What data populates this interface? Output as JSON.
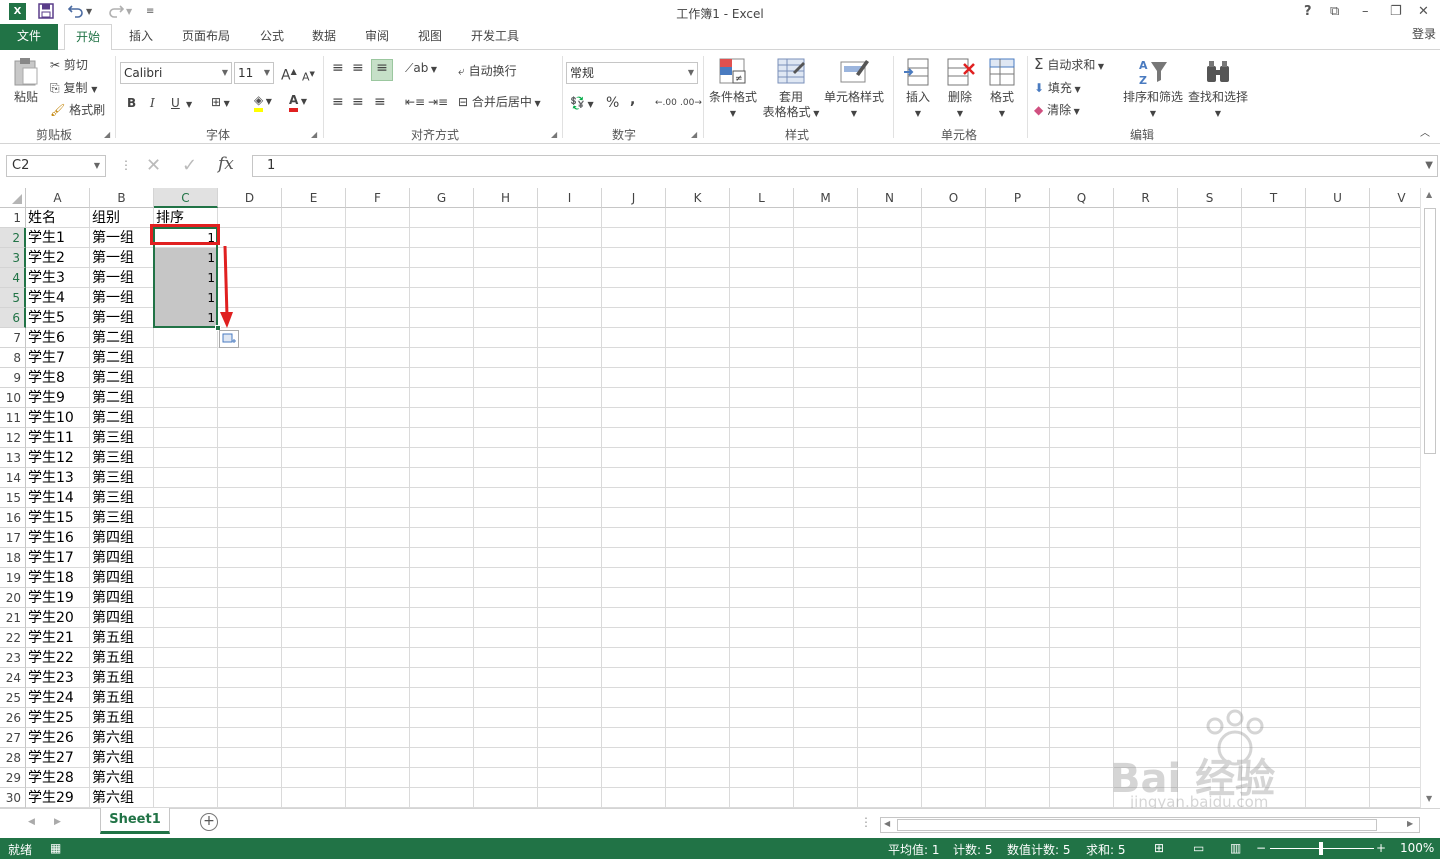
{
  "app": {
    "title": "工作簿1 - Excel",
    "logo_text": "X",
    "login": "登录"
  },
  "titlebar": {
    "help": "?",
    "ribbon_opts": "⧉",
    "minimize": "–",
    "restore": "❐",
    "close": "✕",
    "save_icon": "save-icon",
    "undo_icon": "undo-icon",
    "redo_icon": "redo-icon"
  },
  "tabs": [
    {
      "label": "文件"
    },
    {
      "label": "开始"
    },
    {
      "label": "插入"
    },
    {
      "label": "页面布局"
    },
    {
      "label": "公式"
    },
    {
      "label": "数据"
    },
    {
      "label": "审阅"
    },
    {
      "label": "视图"
    },
    {
      "label": "开发工具"
    }
  ],
  "ribbon": {
    "clipboard": {
      "paste": "粘贴",
      "cut": "剪切",
      "copy": "复制",
      "format_painter": "格式刷",
      "label": "剪贴板"
    },
    "font": {
      "name": "Calibri",
      "size": "11",
      "grow": "A",
      "shrink": "A",
      "bold": "B",
      "italic": "I",
      "underline": "U",
      "font_color_letter": "A",
      "label": "字体"
    },
    "align": {
      "wrap": "自动换行",
      "merge": "合并后居中",
      "label": "对齐方式"
    },
    "number": {
      "format": "常规",
      "percent": "%",
      "comma": ",",
      "label": "数字"
    },
    "styles": {
      "conditional": "条件格式",
      "table_format": [
        "套用",
        "表格格式"
      ],
      "cell_styles": "单元格样式",
      "label": "样式"
    },
    "cells": {
      "insert": "插入",
      "delete": "删除",
      "format": "格式",
      "label": "单元格"
    },
    "editing": {
      "autosum": "自动求和",
      "fill": "填充",
      "clear": "清除",
      "sort_filter": "排序和筛选",
      "find_select": "查找和选择",
      "label": "编辑"
    }
  },
  "formula_bar": {
    "name_box": "C2",
    "fx": "fx",
    "value": "1"
  },
  "columns": [
    "A",
    "B",
    "C",
    "D",
    "E",
    "F",
    "G",
    "H",
    "I",
    "J",
    "K",
    "L",
    "M",
    "N",
    "O",
    "P",
    "Q",
    "R",
    "S",
    "T",
    "U",
    "V"
  ],
  "rows": [
    {
      "n": "1",
      "a": "姓名",
      "b": "组别",
      "c": "排序"
    },
    {
      "n": "2",
      "a": "学生1",
      "b": "第一组",
      "c": "1"
    },
    {
      "n": "3",
      "a": "学生2",
      "b": "第一组",
      "c": "1"
    },
    {
      "n": "4",
      "a": "学生3",
      "b": "第一组",
      "c": "1"
    },
    {
      "n": "5",
      "a": "学生4",
      "b": "第一组",
      "c": "1"
    },
    {
      "n": "6",
      "a": "学生5",
      "b": "第一组",
      "c": "1"
    },
    {
      "n": "7",
      "a": "学生6",
      "b": "第二组",
      "c": ""
    },
    {
      "n": "8",
      "a": "学生7",
      "b": "第二组",
      "c": ""
    },
    {
      "n": "9",
      "a": "学生8",
      "b": "第二组",
      "c": ""
    },
    {
      "n": "10",
      "a": "学生9",
      "b": "第二组",
      "c": ""
    },
    {
      "n": "11",
      "a": "学生10",
      "b": "第二组",
      "c": ""
    },
    {
      "n": "12",
      "a": "学生11",
      "b": "第三组",
      "c": ""
    },
    {
      "n": "13",
      "a": "学生12",
      "b": "第三组",
      "c": ""
    },
    {
      "n": "14",
      "a": "学生13",
      "b": "第三组",
      "c": ""
    },
    {
      "n": "15",
      "a": "学生14",
      "b": "第三组",
      "c": ""
    },
    {
      "n": "16",
      "a": "学生15",
      "b": "第三组",
      "c": ""
    },
    {
      "n": "17",
      "a": "学生16",
      "b": "第四组",
      "c": ""
    },
    {
      "n": "18",
      "a": "学生17",
      "b": "第四组",
      "c": ""
    },
    {
      "n": "19",
      "a": "学生18",
      "b": "第四组",
      "c": ""
    },
    {
      "n": "20",
      "a": "学生19",
      "b": "第四组",
      "c": ""
    },
    {
      "n": "21",
      "a": "学生20",
      "b": "第四组",
      "c": ""
    },
    {
      "n": "22",
      "a": "学生21",
      "b": "第五组",
      "c": ""
    },
    {
      "n": "23",
      "a": "学生22",
      "b": "第五组",
      "c": ""
    },
    {
      "n": "24",
      "a": "学生23",
      "b": "第五组",
      "c": ""
    },
    {
      "n": "25",
      "a": "学生24",
      "b": "第五组",
      "c": ""
    },
    {
      "n": "26",
      "a": "学生25",
      "b": "第五组",
      "c": ""
    },
    {
      "n": "27",
      "a": "学生26",
      "b": "第六组",
      "c": ""
    },
    {
      "n": "28",
      "a": "学生27",
      "b": "第六组",
      "c": ""
    },
    {
      "n": "29",
      "a": "学生28",
      "b": "第六组",
      "c": ""
    },
    {
      "n": "30",
      "a": "学生29",
      "b": "第六组",
      "c": ""
    }
  ],
  "sheet_tabs": [
    {
      "label": "Sheet1"
    }
  ],
  "status": {
    "ready": "就绪",
    "average": "平均值: 1",
    "count": "计数: 5",
    "num_count": "数值计数: 5",
    "sum": "求和: 5",
    "zoom": "100%"
  },
  "colors": {
    "excel_green": "#217346",
    "selection_fill": "#c6c6c6",
    "annotation_red": "#e02020"
  },
  "watermark": {
    "text": "Bai 经验",
    "url": "jingyan.baidu.com"
  }
}
